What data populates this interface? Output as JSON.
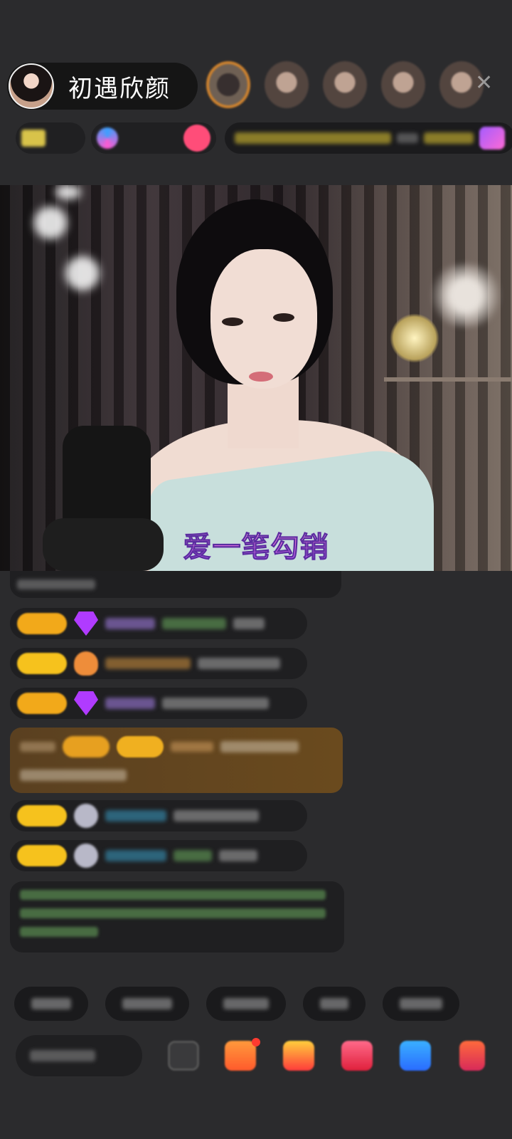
{
  "header": {
    "host_name": "初遇欣颜",
    "close_icon": "close-icon",
    "viewer_count": 5
  },
  "info_row": {
    "items": [
      "",
      "",
      ""
    ],
    "ticker": ""
  },
  "video": {
    "song_title": "爱一笔勾销"
  },
  "chat": {
    "messages": [
      {
        "type": "system",
        "text": ""
      },
      {
        "type": "gift",
        "badge_color": "#f2a91a",
        "icon": "gem-icon",
        "user": "",
        "content": ""
      },
      {
        "type": "text",
        "badge_color": "#f6c21d",
        "icon": "heart-icon",
        "user": "",
        "content": ""
      },
      {
        "type": "text",
        "badge_color": "#f2a91a",
        "icon": "gem-icon",
        "user": "",
        "content": ""
      },
      {
        "type": "highlight",
        "content": ""
      },
      {
        "type": "text",
        "badge_color": "#f6c21d",
        "icon": "fan-icon",
        "user": "",
        "content": ""
      },
      {
        "type": "text",
        "badge_color": "#f6c21d",
        "icon": "fan-icon",
        "user": "",
        "content": ""
      },
      {
        "type": "notice",
        "content": ""
      }
    ]
  },
  "quick_replies": [
    "",
    "",
    "",
    "",
    ""
  ],
  "bottom_bar": {
    "say_placeholder": "",
    "icons": [
      "chat-icon",
      "gift-box-icon",
      "red-envelope-icon",
      "heart-gift-icon",
      "game-icon",
      "more-icon"
    ]
  },
  "colors": {
    "background": "#2b2b2d",
    "accent_orange": "#e9912f",
    "badge_yellow": "#f6c21d",
    "song_title_pink": "#f47be0"
  }
}
